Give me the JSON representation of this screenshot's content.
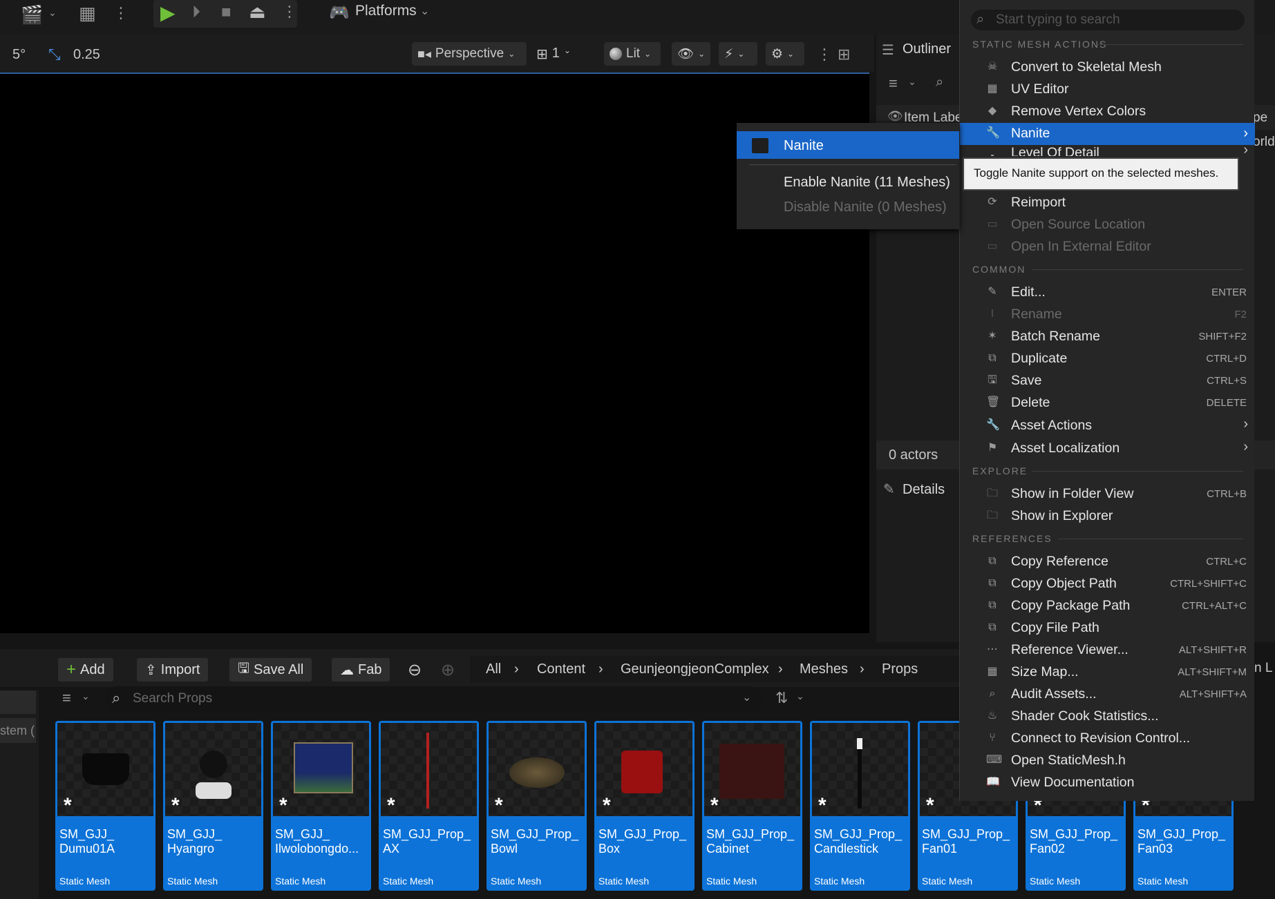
{
  "toolbar": {
    "platforms_label": "Platforms"
  },
  "viewport_bar": {
    "rotation_snap": "5°",
    "scale_snap": "0.25",
    "view_mode": "Perspective",
    "camera_speed": "1",
    "lighting_mode": "Lit"
  },
  "outliner": {
    "title": "Outliner",
    "column_label": "Item Labe",
    "column_right": "pe",
    "world_text": "orld",
    "actors_count": "0 actors",
    "details_title": "Details",
    "side_text": "n L"
  },
  "nanite_submenu": {
    "header": "Nanite",
    "items": [
      "Enable Nanite (11 Meshes)",
      "Disable Nanite (0 Meshes)"
    ]
  },
  "context_menu": {
    "search_placeholder": "Start typing to search",
    "sections": {
      "static_mesh_actions": "STATIC MESH ACTIONS",
      "common": "COMMON",
      "explore": "EXPLORE",
      "references": "REFERENCES"
    },
    "static_mesh_items": [
      {
        "label": "Convert to Skeletal Mesh",
        "icon": "skeleton-icon"
      },
      {
        "label": "UV Editor",
        "icon": "grid-icon"
      },
      {
        "label": "Remove Vertex Colors",
        "icon": "drop-icon"
      },
      {
        "label": "Nanite",
        "icon": "wrench-icon"
      },
      {
        "label": "Level Of Detail",
        "icon": "lod-icon"
      }
    ],
    "tooltip": "Toggle Nanite support on the selected meshes.",
    "source_items": [
      {
        "label": "Reimport",
        "icon": "reimport-icon"
      },
      {
        "label": "Open Source Location",
        "icon": "folder-icon"
      },
      {
        "label": "Open In External Editor",
        "icon": "external-icon"
      }
    ],
    "common_items": [
      {
        "label": "Edit...",
        "shortcut": "ENTER",
        "icon": "pencil-icon"
      },
      {
        "label": "Rename",
        "shortcut": "F2",
        "icon": "rename-icon"
      },
      {
        "label": "Batch Rename",
        "shortcut": "SHIFT+F2",
        "icon": "star-icon"
      },
      {
        "label": "Duplicate",
        "shortcut": "CTRL+D",
        "icon": "duplicate-icon"
      },
      {
        "label": "Save",
        "shortcut": "CTRL+S",
        "icon": "save-icon"
      },
      {
        "label": "Delete",
        "shortcut": "DELETE",
        "icon": "trash-icon"
      },
      {
        "label": "Asset Actions",
        "shortcut": "",
        "icon": "wrench-icon"
      },
      {
        "label": "Asset Localization",
        "shortcut": "",
        "icon": "flag-icon"
      }
    ],
    "explore_items": [
      {
        "label": "Show in Folder View",
        "shortcut": "CTRL+B",
        "icon": "folder-search-icon"
      },
      {
        "label": "Show in Explorer",
        "shortcut": "",
        "icon": "folder-search-icon"
      }
    ],
    "reference_items": [
      {
        "label": "Copy Reference",
        "shortcut": "CTRL+C",
        "icon": "copy-icon"
      },
      {
        "label": "Copy Object Path",
        "shortcut": "CTRL+SHIFT+C",
        "icon": "copy-icon"
      },
      {
        "label": "Copy Package Path",
        "shortcut": "CTRL+ALT+C",
        "icon": "copy-icon"
      },
      {
        "label": "Copy File Path",
        "shortcut": "",
        "icon": "copy-icon"
      },
      {
        "label": "Reference Viewer...",
        "shortcut": "ALT+SHIFT+R",
        "icon": "graph-icon"
      },
      {
        "label": "Size Map...",
        "shortcut": "ALT+SHIFT+M",
        "icon": "sizemap-icon"
      },
      {
        "label": "Audit Assets...",
        "shortcut": "ALT+SHIFT+A",
        "icon": "audit-icon"
      },
      {
        "label": "Shader Cook Statistics...",
        "shortcut": "",
        "icon": "shader-icon"
      },
      {
        "label": "Connect to Revision Control...",
        "shortcut": "",
        "icon": "branch-icon"
      },
      {
        "label": "Open StaticMesh.h",
        "shortcut": "",
        "icon": "code-icon"
      },
      {
        "label": "View Documentation",
        "shortcut": "",
        "icon": "book-icon"
      }
    ]
  },
  "content_browser": {
    "add_label": "Add",
    "import_label": "Import",
    "save_all_label": "Save All",
    "fab_label": "Fab",
    "breadcrumb": [
      "All",
      "Content",
      "GeunjeongjeonComplex",
      "Meshes",
      "Props"
    ],
    "search_placeholder": "Search Props",
    "left_text": "stem (",
    "assets": [
      {
        "name": "SM_GJJ_\nDumu01A",
        "type": "Static Mesh"
      },
      {
        "name": "SM_GJJ_\nHyangro",
        "type": "Static Mesh"
      },
      {
        "name": "SM_GJJ_\nIlwolobongdo...",
        "type": "Static Mesh"
      },
      {
        "name": "SM_GJJ_Prop_\nAX",
        "type": "Static Mesh"
      },
      {
        "name": "SM_GJJ_Prop_\nBowl",
        "type": "Static Mesh"
      },
      {
        "name": "SM_GJJ_Prop_\nBox",
        "type": "Static Mesh"
      },
      {
        "name": "SM_GJJ_Prop_\nCabinet",
        "type": "Static Mesh"
      },
      {
        "name": "SM_GJJ_Prop_\nCandlestick",
        "type": "Static Mesh"
      },
      {
        "name": "SM_GJJ_Prop_\nFan01",
        "type": "Static Mesh"
      },
      {
        "name": "SM_GJJ_Prop_\nFan02",
        "type": "Static Mesh"
      },
      {
        "name": "SM_GJJ_Prop_\nFan03",
        "type": "Static Mesh"
      }
    ]
  },
  "colors": {
    "accent": "#0d73d8",
    "highlight": "#1a66c8",
    "menu_bg": "#262626",
    "play_green": "#6fbf3a"
  }
}
